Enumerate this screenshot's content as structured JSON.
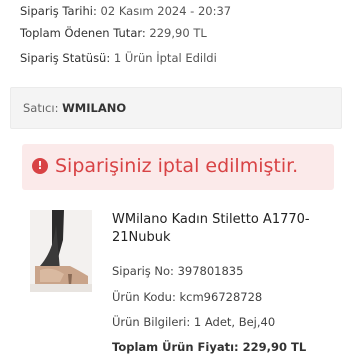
{
  "order": {
    "date_label": "Sipariş Tarihi:",
    "date_value": "02 Kasım 2024 - 20:37",
    "total_label": "Toplam Ödenen Tutar:",
    "total_value": "229,90 TL",
    "status_label": "Sipariş Statüsü:",
    "status_value": "1 Ürün İptal Edildi"
  },
  "seller": {
    "prefix": "Satıcı:",
    "name": "WMILANO"
  },
  "alert": {
    "icon": "exclamation-icon",
    "text": "Siparişiniz iptal edilmiştir."
  },
  "product": {
    "title": "WMilano Kadın Stiletto A1770-21Nubuk",
    "order_no": "Sipariş No: 397801835",
    "product_code": "Ürün Kodu: kcm96728728",
    "info": "Ürün Bilgileri: 1 Adet, Bej,40",
    "total_price": "Toplam Ürün Fiyatı: 229,90 TL"
  },
  "colors": {
    "alert_red": "#d84345",
    "alert_bg": "#fbeaea"
  }
}
